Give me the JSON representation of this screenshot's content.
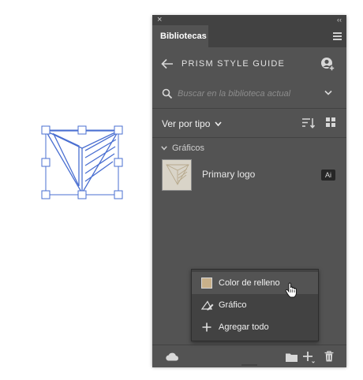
{
  "panel": {
    "tab_label": "Bibliotecas",
    "close_glyph": "×",
    "collapse_glyph": "‹‹"
  },
  "header": {
    "library_name": "PRISM STYLE GUIDE",
    "back_icon": "arrow-left-icon",
    "user_icon": "add-user-icon"
  },
  "search": {
    "placeholder": "Buscar en la biblioteca actual",
    "value": ""
  },
  "view": {
    "label": "Ver por tipo"
  },
  "section": {
    "label": "Gráficos"
  },
  "items": [
    {
      "name": "Primary logo",
      "badge": "Ai"
    }
  ],
  "popup_menu": [
    {
      "label": "Color de relleno",
      "icon": "color-swatch",
      "highlighted": true
    },
    {
      "label": "Gráfico",
      "icon": "graphic-icon",
      "highlighted": false
    },
    {
      "label": "Agregar todo",
      "icon": "plus-icon",
      "highlighted": false
    }
  ],
  "colors": {
    "panel_bg": "#535353",
    "panel_dark": "#424242",
    "fill_swatch": "#c8b08a",
    "selection_blue": "#4a6fd1"
  }
}
